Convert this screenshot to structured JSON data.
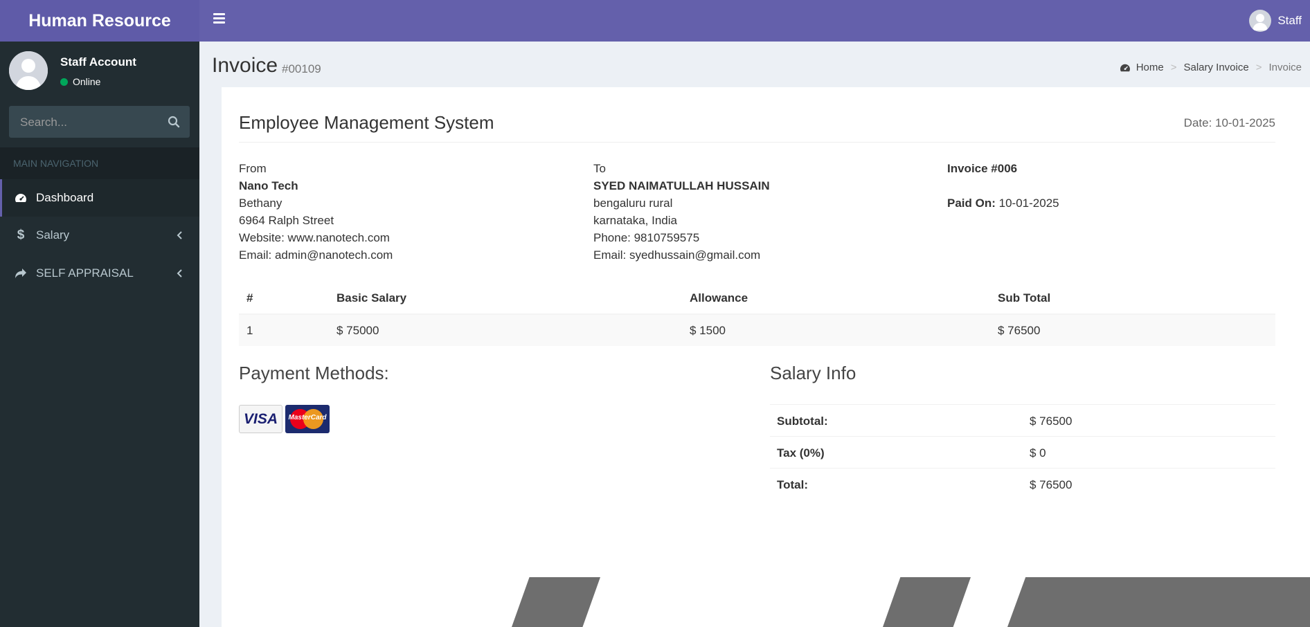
{
  "app": {
    "title": "Human Resource"
  },
  "topbar": {
    "user_name": "Staff"
  },
  "sidebar": {
    "user": {
      "name": "Staff Account",
      "status": "Online"
    },
    "search": {
      "placeholder": "Search..."
    },
    "nav_header": "MAIN NAVIGATION",
    "items": [
      {
        "label": "Dashboard",
        "icon": "dashboard-icon",
        "active": true
      },
      {
        "label": "Salary",
        "icon": "dollar-icon"
      },
      {
        "label": "SELF APPRAISAL",
        "icon": "share-icon"
      }
    ]
  },
  "page": {
    "title": "Invoice",
    "subtitle": "#00109",
    "breadcrumb": [
      "Home",
      "Salary Invoice",
      "Invoice"
    ]
  },
  "invoice": {
    "company": "Employee Management System",
    "date": "Date: 10-01-2025",
    "from": {
      "label": "From",
      "name": "Nano Tech",
      "line1": "Bethany",
      "line2": "6964 Ralph Street",
      "website": "Website: www.nanotech.com",
      "email": "Email: admin@nanotech.com"
    },
    "to": {
      "label": "To",
      "name": "SYED NAIMATULLAH HUSSAIN",
      "line1": "bengaluru rural",
      "line2": "karnataka, India",
      "phone": "Phone: 9810759575",
      "email": "Email: syedhussain@gmail.com"
    },
    "meta": {
      "invoice_no": "Invoice #006",
      "paid_label": "Paid On:",
      "paid_value": "10-01-2025"
    },
    "table": {
      "headers": [
        "#",
        "Basic Salary",
        "Allowance",
        "Sub Total"
      ],
      "rows": [
        [
          "1",
          "$ 75000",
          "$ 1500",
          "$ 76500"
        ]
      ]
    },
    "payment": {
      "title": "Payment Methods:",
      "cards": [
        "VISA",
        "MasterCard"
      ]
    },
    "salary_info": {
      "title": "Salary Info",
      "rows": [
        {
          "label": "Subtotal:",
          "value": "$ 76500"
        },
        {
          "label": "Tax (0%)",
          "value": "$ 0"
        },
        {
          "label": "Total:",
          "value": "$ 76500"
        }
      ]
    }
  },
  "colors": {
    "primary": "#6460ab",
    "sidebar": "#222d32",
    "online": "#00a65a"
  }
}
